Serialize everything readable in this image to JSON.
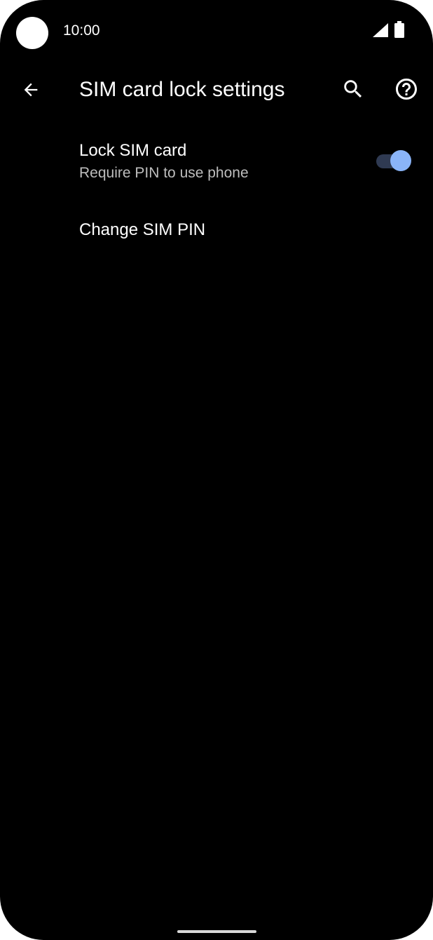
{
  "status_bar": {
    "time": "10:00",
    "icons": [
      "front-camera",
      "cellular-signal-icon",
      "battery-icon"
    ]
  },
  "app_bar": {
    "title": "SIM card lock settings",
    "icons": {
      "back": "arrow-back-icon",
      "search": "search-icon",
      "help": "help-icon"
    }
  },
  "preferences": [
    {
      "title": "Lock SIM card",
      "summary": "Require PIN to use phone",
      "toggle_on": true
    },
    {
      "title": "Change SIM PIN"
    }
  ],
  "colors": {
    "background": "#000000",
    "text_primary": "#ffffff",
    "text_secondary": "#bdbdbd",
    "toggle_thumb": "#8ab4f8",
    "toggle_track": "#2f3a52"
  }
}
